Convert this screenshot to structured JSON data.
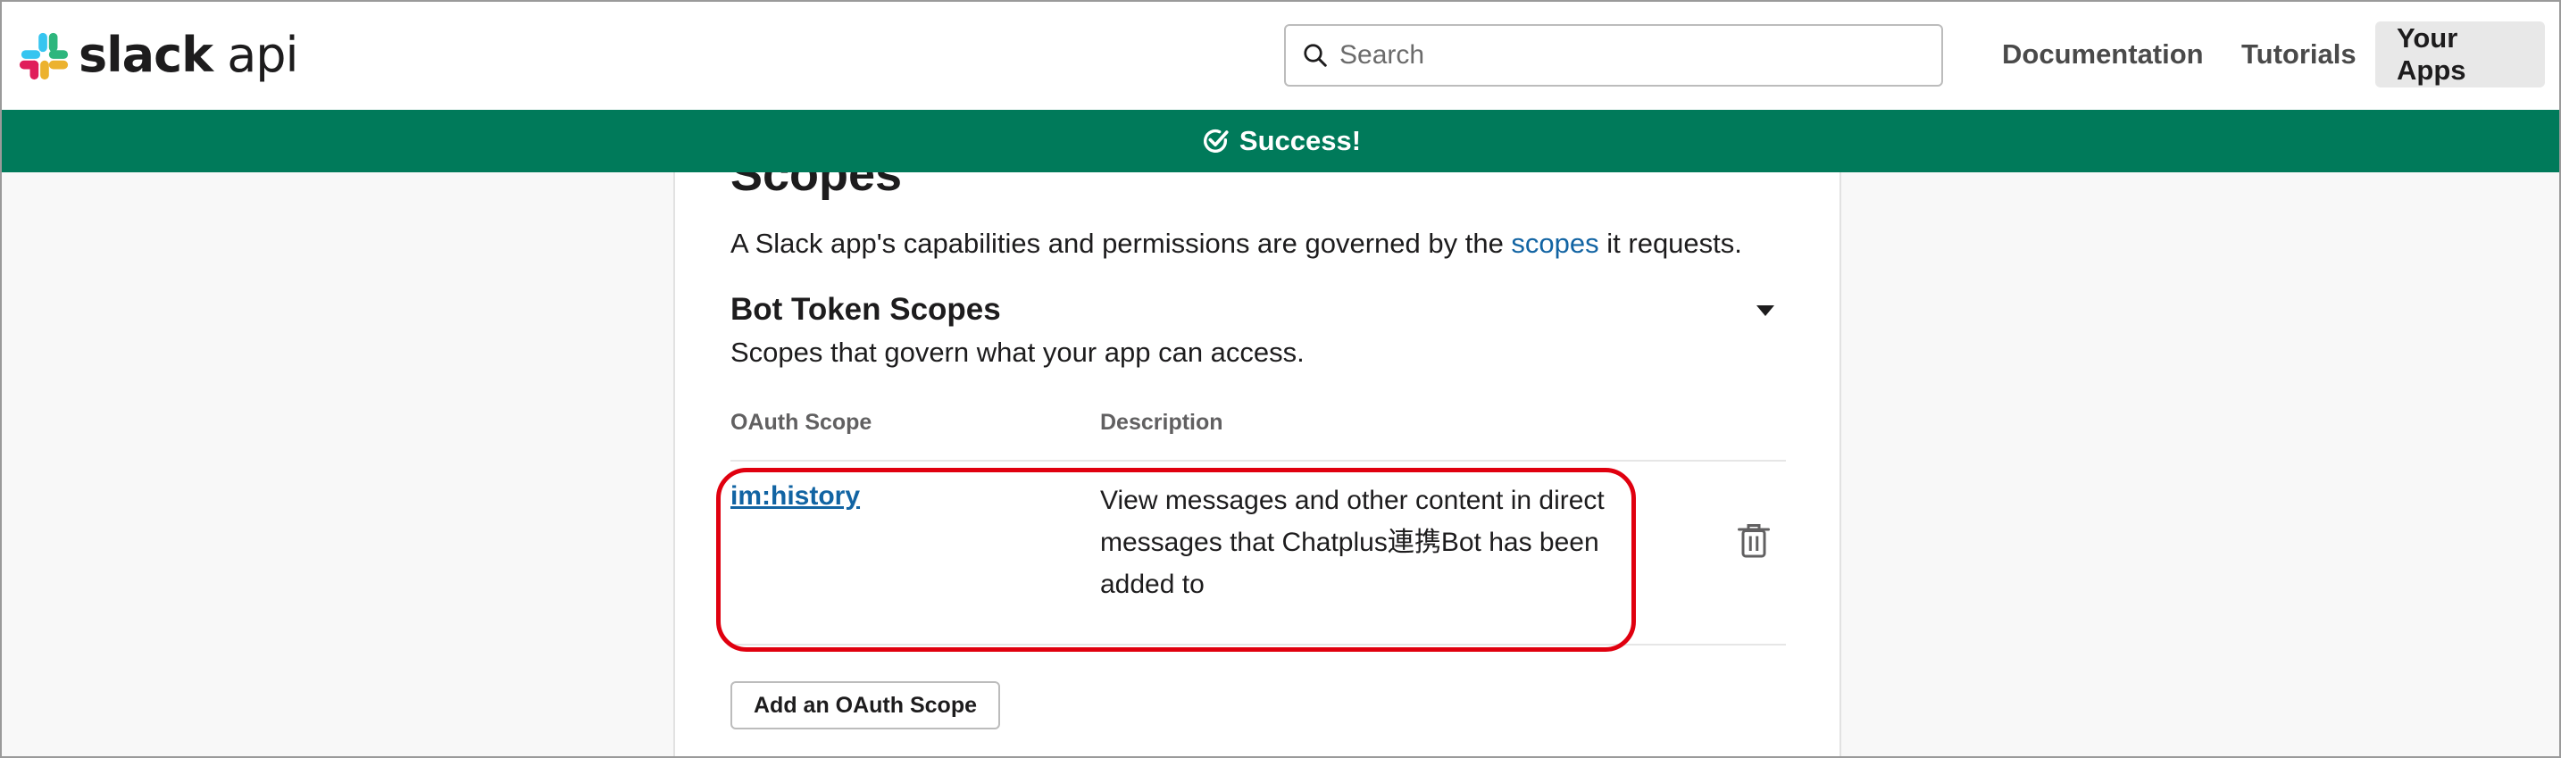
{
  "header": {
    "logo_brand": "slack",
    "logo_suffix": "api",
    "search_placeholder": "Search",
    "nav": [
      {
        "label": "Documentation"
      },
      {
        "label": "Tutorials"
      },
      {
        "label": "Your Apps"
      }
    ]
  },
  "banner": {
    "text": "Success!",
    "color": "#007a5a"
  },
  "main": {
    "section_title": "Scopes",
    "intro_before": "A Slack app's capabilities and permissions are governed by the ",
    "intro_link": "scopes",
    "intro_after": " it requests.",
    "bot_scopes": {
      "title": "Bot Token Scopes",
      "description": "Scopes that govern what your app can access.",
      "columns": [
        "OAuth Scope",
        "Description"
      ],
      "rows": [
        {
          "scope": "im:history",
          "description": "View messages and other content in direct messages that Chatplus連携Bot has been added to"
        }
      ],
      "add_button": "Add an OAuth Scope"
    }
  },
  "colors": {
    "link": "#1264a3",
    "highlight": "#e0000f"
  }
}
